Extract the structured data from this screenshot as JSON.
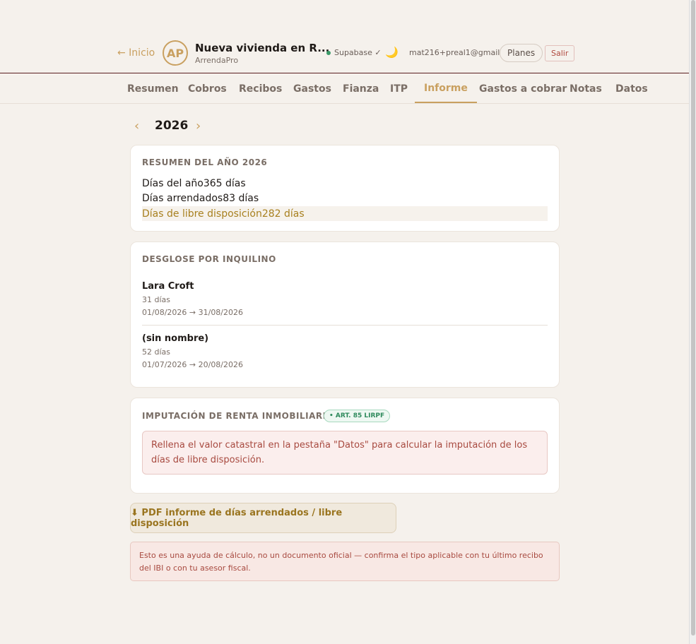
{
  "header": {
    "back_label": "← Inicio",
    "avatar_initials": "AP",
    "property_title": "Nueva vivienda en R...",
    "property_subtitle": "ArrendaPro",
    "status_label": "Supabase ✓",
    "theme_icon": "moon-icon",
    "email": "mat216+preal1@gmail...",
    "plans_label": "Planes",
    "logout_label": "Salir"
  },
  "tabs": [
    {
      "label": "Resumen",
      "active": false
    },
    {
      "label": "Cobros",
      "active": false
    },
    {
      "label": "Recibos",
      "active": false
    },
    {
      "label": "Gastos",
      "active": false
    },
    {
      "label": "Fianza",
      "active": false
    },
    {
      "label": "ITP",
      "active": false
    },
    {
      "label": "Informe",
      "active": true
    },
    {
      "label": "Gastos a cobrar",
      "active": false
    },
    {
      "label": "Notas",
      "active": false
    },
    {
      "label": "Datos",
      "active": false
    }
  ],
  "year_nav": {
    "prev": "‹",
    "year": "2026",
    "next": "›"
  },
  "summary": {
    "title": "RESUMEN DEL AÑO 2026",
    "rows": [
      {
        "label": "Días del año",
        "value": "365 días"
      },
      {
        "label": "Días arrendados",
        "value": "83 días"
      },
      {
        "label": "Días de libre disposición",
        "value": "282 días"
      }
    ]
  },
  "breakdown": {
    "title": "DESGLOSE POR INQUILINO",
    "tenants": [
      {
        "name": "Lara Croft",
        "days": "31 días",
        "range": "01/08/2026 → 31/08/2026"
      },
      {
        "name": "(sin nombre)",
        "days": "52 días",
        "range": "01/07/2026 → 20/08/2026"
      }
    ]
  },
  "imputation": {
    "title": "IMPUTACIÓN DE RENTA INMOBILIARIA",
    "badge": "• ART. 85 LIRPF",
    "alert": "Rellena el valor catastral en la pestaña \"Datos\" para calcular la imputación de los días de libre disposición."
  },
  "pdf_button": "⬇ PDF informe de días arrendados / libre disposición",
  "disclaimer": "Esto es una ayuda de cálculo, no un documento oficial — confirma el tipo aplicable con tu último recibo del IBI o con tu asesor fiscal.",
  "colors": {
    "accent": "#c9a060",
    "background": "#f5f1ec",
    "success": "#2e8a5c",
    "danger": "#a84a40"
  }
}
